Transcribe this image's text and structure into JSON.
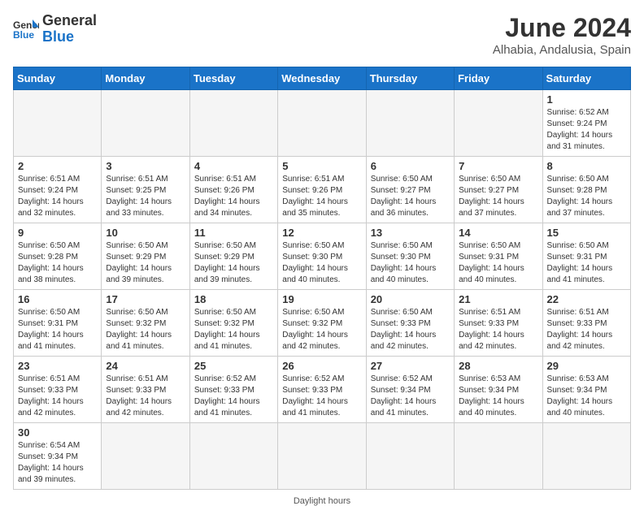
{
  "header": {
    "logo_general": "General",
    "logo_blue": "Blue",
    "month_year": "June 2024",
    "location": "Alhabia, Andalusia, Spain"
  },
  "weekdays": [
    "Sunday",
    "Monday",
    "Tuesday",
    "Wednesday",
    "Thursday",
    "Friday",
    "Saturday"
  ],
  "weeks": [
    [
      {
        "day": "",
        "info": ""
      },
      {
        "day": "",
        "info": ""
      },
      {
        "day": "",
        "info": ""
      },
      {
        "day": "",
        "info": ""
      },
      {
        "day": "",
        "info": ""
      },
      {
        "day": "",
        "info": ""
      },
      {
        "day": "1",
        "info": "Sunrise: 6:52 AM\nSunset: 9:24 PM\nDaylight: 14 hours and 31 minutes."
      }
    ],
    [
      {
        "day": "2",
        "info": "Sunrise: 6:51 AM\nSunset: 9:24 PM\nDaylight: 14 hours and 32 minutes."
      },
      {
        "day": "3",
        "info": "Sunrise: 6:51 AM\nSunset: 9:25 PM\nDaylight: 14 hours and 33 minutes."
      },
      {
        "day": "4",
        "info": "Sunrise: 6:51 AM\nSunset: 9:26 PM\nDaylight: 14 hours and 34 minutes."
      },
      {
        "day": "5",
        "info": "Sunrise: 6:51 AM\nSunset: 9:26 PM\nDaylight: 14 hours and 35 minutes."
      },
      {
        "day": "6",
        "info": "Sunrise: 6:50 AM\nSunset: 9:27 PM\nDaylight: 14 hours and 36 minutes."
      },
      {
        "day": "7",
        "info": "Sunrise: 6:50 AM\nSunset: 9:27 PM\nDaylight: 14 hours and 37 minutes."
      },
      {
        "day": "8",
        "info": "Sunrise: 6:50 AM\nSunset: 9:28 PM\nDaylight: 14 hours and 37 minutes."
      }
    ],
    [
      {
        "day": "9",
        "info": "Sunrise: 6:50 AM\nSunset: 9:28 PM\nDaylight: 14 hours and 38 minutes."
      },
      {
        "day": "10",
        "info": "Sunrise: 6:50 AM\nSunset: 9:29 PM\nDaylight: 14 hours and 39 minutes."
      },
      {
        "day": "11",
        "info": "Sunrise: 6:50 AM\nSunset: 9:29 PM\nDaylight: 14 hours and 39 minutes."
      },
      {
        "day": "12",
        "info": "Sunrise: 6:50 AM\nSunset: 9:30 PM\nDaylight: 14 hours and 40 minutes."
      },
      {
        "day": "13",
        "info": "Sunrise: 6:50 AM\nSunset: 9:30 PM\nDaylight: 14 hours and 40 minutes."
      },
      {
        "day": "14",
        "info": "Sunrise: 6:50 AM\nSunset: 9:31 PM\nDaylight: 14 hours and 40 minutes."
      },
      {
        "day": "15",
        "info": "Sunrise: 6:50 AM\nSunset: 9:31 PM\nDaylight: 14 hours and 41 minutes."
      }
    ],
    [
      {
        "day": "16",
        "info": "Sunrise: 6:50 AM\nSunset: 9:31 PM\nDaylight: 14 hours and 41 minutes."
      },
      {
        "day": "17",
        "info": "Sunrise: 6:50 AM\nSunset: 9:32 PM\nDaylight: 14 hours and 41 minutes."
      },
      {
        "day": "18",
        "info": "Sunrise: 6:50 AM\nSunset: 9:32 PM\nDaylight: 14 hours and 41 minutes."
      },
      {
        "day": "19",
        "info": "Sunrise: 6:50 AM\nSunset: 9:32 PM\nDaylight: 14 hours and 42 minutes."
      },
      {
        "day": "20",
        "info": "Sunrise: 6:50 AM\nSunset: 9:33 PM\nDaylight: 14 hours and 42 minutes."
      },
      {
        "day": "21",
        "info": "Sunrise: 6:51 AM\nSunset: 9:33 PM\nDaylight: 14 hours and 42 minutes."
      },
      {
        "day": "22",
        "info": "Sunrise: 6:51 AM\nSunset: 9:33 PM\nDaylight: 14 hours and 42 minutes."
      }
    ],
    [
      {
        "day": "23",
        "info": "Sunrise: 6:51 AM\nSunset: 9:33 PM\nDaylight: 14 hours and 42 minutes."
      },
      {
        "day": "24",
        "info": "Sunrise: 6:51 AM\nSunset: 9:33 PM\nDaylight: 14 hours and 42 minutes."
      },
      {
        "day": "25",
        "info": "Sunrise: 6:52 AM\nSunset: 9:33 PM\nDaylight: 14 hours and 41 minutes."
      },
      {
        "day": "26",
        "info": "Sunrise: 6:52 AM\nSunset: 9:33 PM\nDaylight: 14 hours and 41 minutes."
      },
      {
        "day": "27",
        "info": "Sunrise: 6:52 AM\nSunset: 9:34 PM\nDaylight: 14 hours and 41 minutes."
      },
      {
        "day": "28",
        "info": "Sunrise: 6:53 AM\nSunset: 9:34 PM\nDaylight: 14 hours and 40 minutes."
      },
      {
        "day": "29",
        "info": "Sunrise: 6:53 AM\nSunset: 9:34 PM\nDaylight: 14 hours and 40 minutes."
      }
    ],
    [
      {
        "day": "30",
        "info": "Sunrise: 6:54 AM\nSunset: 9:34 PM\nDaylight: 14 hours and 39 minutes."
      },
      {
        "day": "",
        "info": ""
      },
      {
        "day": "",
        "info": ""
      },
      {
        "day": "",
        "info": ""
      },
      {
        "day": "",
        "info": ""
      },
      {
        "day": "",
        "info": ""
      },
      {
        "day": "",
        "info": ""
      }
    ]
  ],
  "footer": {
    "daylight_label": "Daylight hours"
  }
}
